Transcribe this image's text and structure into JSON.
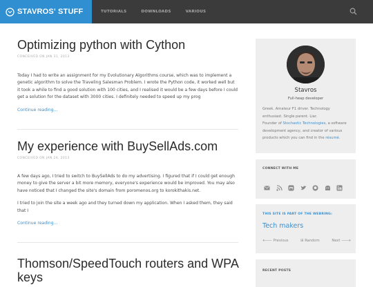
{
  "brand": {
    "title": "STAVROS' STUFF"
  },
  "nav": {
    "items": [
      "TUTORIALS",
      "DOWNLOADS",
      "VARIOUS"
    ]
  },
  "posts": [
    {
      "title": "Optimizing python with Cython",
      "meta": "CONCEIVED ON JAN 31, 2013",
      "paragraphs": [
        "Today I had to write an assignment for my Evolutionary Algorithms course, which was to implement a genetic algorithm to solve the Traveling Salesman Problem. I wrote the Python code, it worked well but it took a while to find a good solution with 100 cities, and I realised it would be a few days before I could get a solution for the dataset with 3000 cities. I definitely needed to speed up my prog"
      ],
      "readmore": "Continue reading…"
    },
    {
      "title": "My experience with BuySellAds.com",
      "meta": "CONCEIVED ON JAN 24, 2013",
      "paragraphs": [
        "A few days ago, I tried to switch to BuySellAds to do my advertising. I figured that if I could get enough money to give the server a bit more memory, everyone's experience would be improved. You may also have noticed that I changed the site's domain from poromenos.org to korokithakis.net.",
        "I tried to join the site a week ago and they turned down my application. When I asked them, they said that I"
      ],
      "readmore": "Continue reading…"
    },
    {
      "title": "Thomson/SpeedTouch routers and WPA keys"
    }
  ],
  "profile": {
    "name": "Stavros",
    "tagline": "Full-heap developer",
    "bio_lines": [
      "Greek. Amateur F1 driver. Technology",
      "enthusiast. Single parent. Liar.",
      "Founder of ",
      "Stochastic Technologies",
      ", a software",
      "development agency, and creator of various",
      "products which you can find in the ",
      "résumé",
      "."
    ]
  },
  "connect": {
    "heading": "CONNECT WITH ME",
    "icons": [
      "email-icon",
      "rss-icon",
      "mastodon-icon",
      "twitter-icon",
      "github-icon",
      "keybase-icon",
      "linkedin-icon"
    ]
  },
  "webring": {
    "heading": "THIS SITE IS PART OF THE WEBRING:",
    "name": "Tech makers",
    "previous": "Previous",
    "random": "Random",
    "next": "Next"
  },
  "recent": {
    "heading": "RECENT POSTS"
  },
  "colors": {
    "accent": "#2f8fd0",
    "topbar": "#3b3b3b",
    "link": "#3a8fcf",
    "sidebar": "#eeeeee"
  }
}
